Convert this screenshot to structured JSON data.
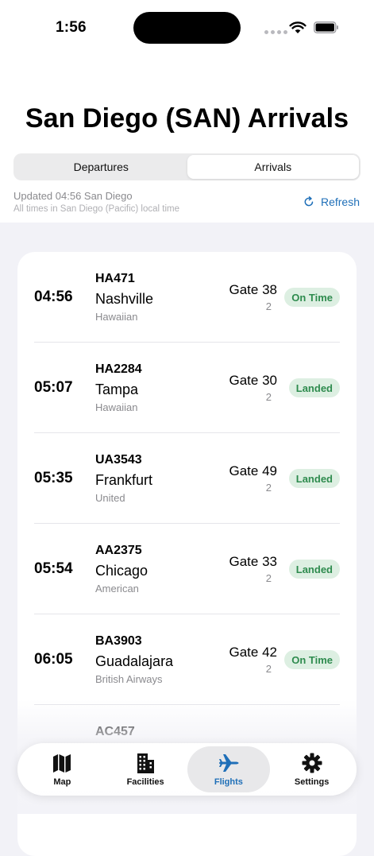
{
  "status_bar": {
    "time": "1:56"
  },
  "header": {
    "title": "San Diego (SAN) Arrivals"
  },
  "segmented": {
    "departures_label": "Departures",
    "arrivals_label": "Arrivals"
  },
  "info": {
    "updated": "Updated 04:56 San Diego",
    "timezone_note": "All times in San Diego (Pacific) local time",
    "refresh_label": "Refresh"
  },
  "flights": [
    {
      "time": "04:56",
      "flight": "HA471",
      "city": "Nashville",
      "airline": "Hawaiian",
      "gate": "Gate 38",
      "terminal": "2",
      "status": "On Time"
    },
    {
      "time": "05:07",
      "flight": "HA2284",
      "city": "Tampa",
      "airline": "Hawaiian",
      "gate": "Gate 30",
      "terminal": "2",
      "status": "Landed"
    },
    {
      "time": "05:35",
      "flight": "UA3543",
      "city": "Frankfurt",
      "airline": "United",
      "gate": "Gate 49",
      "terminal": "2",
      "status": "Landed"
    },
    {
      "time": "05:54",
      "flight": "AA2375",
      "city": "Chicago",
      "airline": "American",
      "gate": "Gate 33",
      "terminal": "2",
      "status": "Landed"
    },
    {
      "time": "06:05",
      "flight": "BA3903",
      "city": "Guadalajara",
      "airline": "British Airways",
      "gate": "Gate 42",
      "terminal": "2",
      "status": "On Time"
    },
    {
      "time": "",
      "flight": "AC457",
      "city": "",
      "airline": "",
      "gate": "",
      "terminal": "",
      "status": ""
    }
  ],
  "tabs": [
    {
      "label": "Map",
      "icon": "map-icon"
    },
    {
      "label": "Facilities",
      "icon": "building-icon"
    },
    {
      "label": "Flights",
      "icon": "airplane-icon"
    },
    {
      "label": "Settings",
      "icon": "gear-icon"
    }
  ],
  "colors": {
    "accent": "#1F6FB8",
    "badge_bg": "#DDEFE2",
    "badge_text": "#2E8B4E",
    "background": "#F2F2F7"
  }
}
